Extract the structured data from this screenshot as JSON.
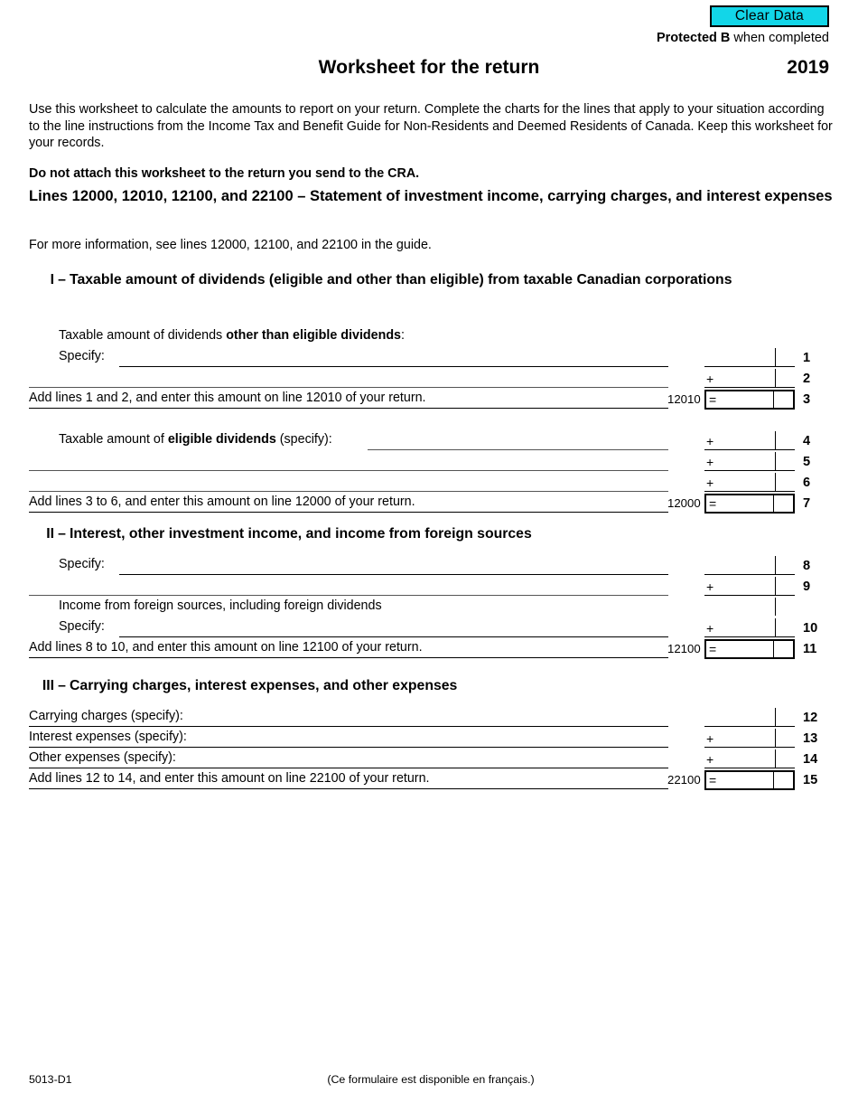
{
  "header": {
    "clear_data_label": "Clear Data",
    "protected_bold": "Protected B",
    "protected_rest": " when completed",
    "title": "Worksheet for the return",
    "year": "2019"
  },
  "intro": {
    "paragraph": "Use this worksheet to calculate the amounts to report on your return. Complete the charts for the lines that apply to your situation according to the line instructions from the Income Tax and Benefit Guide for Non-Residents and Deemed Residents of Canada. Keep this worksheet for your records.",
    "do_not_attach": "Do not attach this worksheet to the return you send to the CRA.",
    "lines_heading_bold": "Lines 12000, 12010, 12100, and 22100",
    "lines_heading_dash": " – ",
    "lines_heading_rest": "Statement of investment income, carrying charges, and interest expenses",
    "more_info": "For more information, see lines 12000, 12100, and 22100 in the guide."
  },
  "sections": [
    {
      "numeral": "I",
      "dash": "–",
      "title": "Taxable amount of dividends (eligible and other than eligible) from taxable Canadian corporations",
      "rows": [
        {
          "label_pre": "Taxable amount of dividends ",
          "label_bold": "other than eligible dividends",
          "label_post": ":",
          "rule": "none",
          "operator": "",
          "code": "",
          "line": "",
          "boxed": false,
          "show_amount": false
        },
        {
          "label_pre": "Specify:",
          "label_bold": "",
          "label_post": "",
          "rule": "full",
          "operator": "",
          "code": "",
          "line": "1",
          "boxed": false,
          "show_amount": true
        },
        {
          "label_pre": "",
          "label_bold": "",
          "label_post": "",
          "rule": "cont-thin",
          "operator": "+",
          "code": "",
          "line": "2",
          "boxed": false,
          "show_amount": true
        },
        {
          "label_pre": "Add lines 1 and 2, and enter this amount on line 12010 of your return.",
          "label_bold": "",
          "label_post": "",
          "rule": "cont",
          "operator": "=",
          "code": "12010",
          "line": "3",
          "boxed": true,
          "show_amount": true
        },
        {
          "spacer": true
        },
        {
          "label_pre": "Taxable amount of ",
          "label_bold": "eligible dividends",
          "label_post": " (specify):",
          "rule": "after-text-thin",
          "operator": "+",
          "code": "",
          "line": "4",
          "boxed": false,
          "show_amount": true
        },
        {
          "label_pre": "",
          "label_bold": "",
          "label_post": "",
          "rule": "cont-thin",
          "operator": "+",
          "code": "",
          "line": "5",
          "boxed": false,
          "show_amount": true
        },
        {
          "label_pre": "",
          "label_bold": "",
          "label_post": "",
          "rule": "cont-thin",
          "operator": "+",
          "code": "",
          "line": "6",
          "boxed": false,
          "show_amount": true
        },
        {
          "label_pre": "Add lines 3 to 6, and enter this amount on line 12000 of your return.",
          "label_bold": "",
          "label_post": "",
          "rule": "cont",
          "operator": "=",
          "code": "12000",
          "line": "7",
          "boxed": true,
          "show_amount": true
        }
      ]
    },
    {
      "numeral": "II",
      "dash": "–",
      "title": "Interest, other investment income, and income from foreign sources",
      "rows": [
        {
          "label_pre": "Specify:",
          "label_bold": "",
          "label_post": "",
          "rule": "full",
          "operator": "",
          "code": "",
          "line": "8",
          "boxed": false,
          "show_amount": true
        },
        {
          "label_pre": "",
          "label_bold": "",
          "label_post": "",
          "rule": "cont-thin",
          "operator": "+",
          "code": "",
          "line": "9",
          "boxed": false,
          "show_amount": true
        },
        {
          "label_pre": "Income from foreign sources, including foreign dividends",
          "label_bold": "",
          "label_post": "",
          "rule": "none",
          "operator": "",
          "code": "",
          "line": "",
          "boxed": false,
          "show_amount": false,
          "divider_only": true
        },
        {
          "label_pre": "Specify:",
          "label_bold": "",
          "label_post": "",
          "rule": "full",
          "operator": "+",
          "code": "",
          "line": "10",
          "boxed": false,
          "show_amount": true
        },
        {
          "label_pre": "Add lines 8 to 10, and enter this amount on line 12100 of your return.",
          "label_bold": "",
          "label_post": "",
          "rule": "cont",
          "operator": "=",
          "code": "12100",
          "line": "11",
          "boxed": true,
          "show_amount": true
        }
      ]
    },
    {
      "numeral": "III",
      "dash": "–",
      "title": "Carrying charges, interest expenses, and other expenses",
      "rows": [
        {
          "label_pre": "Carrying charges (specify):",
          "label_bold": "",
          "label_post": "",
          "rule": "cont",
          "operator": "",
          "code": "",
          "line": "12",
          "boxed": false,
          "show_amount": true
        },
        {
          "label_pre": "Interest expenses (specify):",
          "label_bold": "",
          "label_post": "",
          "rule": "cont",
          "operator": "+",
          "code": "",
          "line": "13",
          "boxed": false,
          "show_amount": true
        },
        {
          "label_pre": "Other expenses (specify):",
          "label_bold": "",
          "label_post": "",
          "rule": "cont",
          "operator": "+",
          "code": "",
          "line": "14",
          "boxed": false,
          "show_amount": true
        },
        {
          "label_pre": "Add lines 12 to 14, and enter this amount on line 22100 of your return.",
          "label_bold": "",
          "label_post": "",
          "rule": "cont",
          "operator": "=",
          "code": "22100",
          "line": "15",
          "boxed": true,
          "show_amount": true
        }
      ]
    }
  ],
  "footer": {
    "form_code": "5013-D1",
    "french_note": "(Ce formulaire est disponible en français.)"
  }
}
